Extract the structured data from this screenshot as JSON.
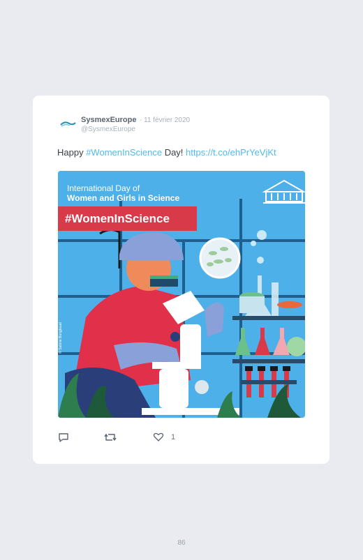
{
  "tweet": {
    "display_name": "SysmexEurope",
    "date": "· 11 février 2020",
    "handle": "@SysmexEurope",
    "text_before": "Happy ",
    "hashtag": "#WomenInScience",
    "text_middle": " Day! ",
    "link": "https://t.co/ehPrYeVjKt"
  },
  "media": {
    "subtitle_line1": "International Day of",
    "subtitle_line2": "Women and Girls in Science",
    "banner_text": "#WomenInScience",
    "org_logo": "UNESCO",
    "side_credit": "© Sabine Bongtouat"
  },
  "actions": {
    "reply_icon": "reply-icon",
    "retweet_icon": "retweet-icon",
    "like_icon": "heart-icon",
    "like_count": "1"
  },
  "colors": {
    "accent": "#55b8e8",
    "banner": "#d83a4a",
    "sky": "#4eb0e8"
  },
  "page_number": "86"
}
